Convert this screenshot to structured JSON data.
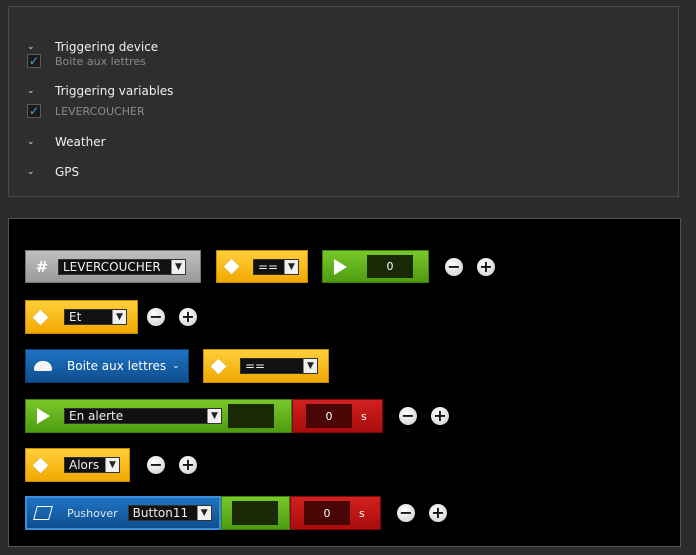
{
  "triggers": {
    "sections": [
      {
        "title": "Triggering device",
        "items": [
          {
            "label": "Boite aux lettres",
            "checked": true
          }
        ]
      },
      {
        "title": "Triggering variables",
        "items": [
          {
            "label": "LEVERCOUCHER",
            "checked": true
          }
        ]
      },
      {
        "title": "Weather",
        "items": []
      },
      {
        "title": "GPS",
        "items": []
      }
    ],
    "chevron": "⌄",
    "check": "✓"
  },
  "editor": {
    "row1": {
      "hash": "#",
      "variable": "LEVERCOUCHER",
      "operator": "==",
      "value": "0"
    },
    "row2": {
      "logic": "Et"
    },
    "row3": {
      "device": "Boite aux lettres",
      "device_caret": "⌄",
      "operator": "=="
    },
    "row4": {
      "state": "En alerte",
      "state_value": "",
      "delay": "0",
      "unit": "s"
    },
    "row5": {
      "logic": "Alors"
    },
    "row6": {
      "action": "Pushover",
      "target": "Button11",
      "target_value": "",
      "delay": "0",
      "unit": "s"
    },
    "arrow": "▼",
    "minus": "−",
    "plus": "+"
  },
  "colors": {
    "check_blue": "#3ea8e8",
    "yellow": "#f2a800",
    "green": "#5aa81a",
    "red": "#b51010",
    "blue": "#155fa5"
  }
}
